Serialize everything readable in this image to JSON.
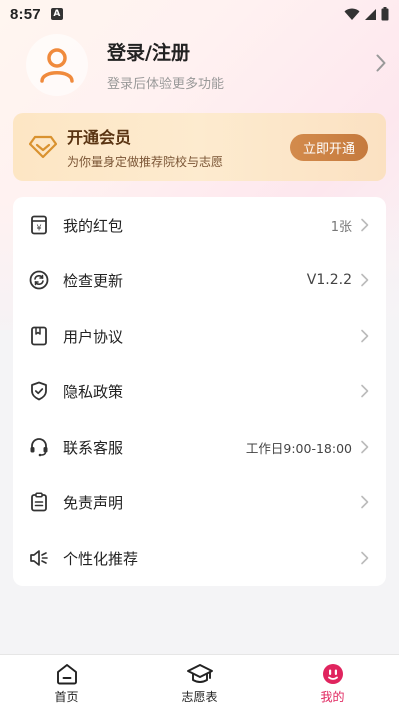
{
  "status_bar": {
    "time": "8:57",
    "notification_letter": "A"
  },
  "profile": {
    "title": "登录/注册",
    "subtitle": "登录后体验更多功能"
  },
  "vip": {
    "title": "开通会员",
    "subtitle": "为你量身定做推荐院校与志愿",
    "button": "立即开通"
  },
  "menu": [
    {
      "label": "我的红包",
      "value": "1张",
      "icon": "red-packet-icon"
    },
    {
      "label": "检查更新",
      "value": "V1.2.2",
      "icon": "refresh-icon"
    },
    {
      "label": "用户协议",
      "value": "",
      "icon": "bookmark-icon"
    },
    {
      "label": "隐私政策",
      "value": "",
      "icon": "shield-check-icon"
    },
    {
      "label": "联系客服",
      "value": "工作日9:00-18:00",
      "icon": "headset-icon"
    },
    {
      "label": "免责声明",
      "value": "",
      "icon": "clipboard-icon"
    },
    {
      "label": "个性化推荐",
      "value": "",
      "icon": "speaker-icon"
    }
  ],
  "tabs": [
    {
      "label": "首页",
      "icon": "home-icon"
    },
    {
      "label": "志愿表",
      "icon": "graduation-cap-icon"
    },
    {
      "label": "我的",
      "icon": "smiley-icon"
    }
  ],
  "colors": {
    "accent": "#e0245e",
    "vip_button": "#c97d40",
    "avatar": "#f08a3c"
  }
}
